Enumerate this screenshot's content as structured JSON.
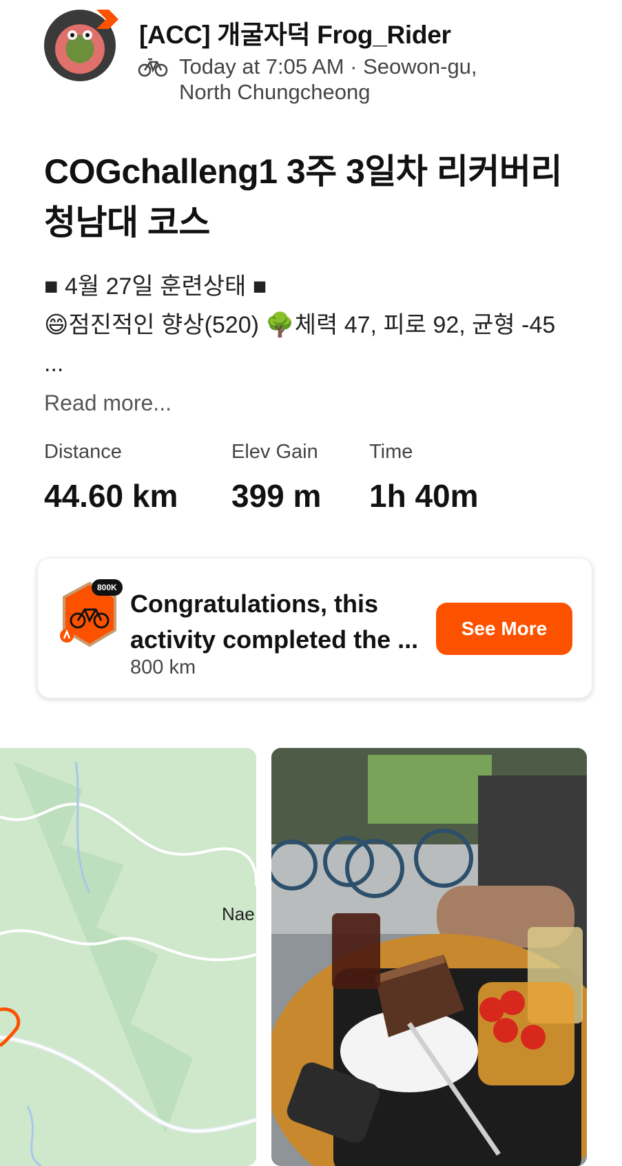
{
  "athlete": {
    "name": "[ACC] 개굴자덕 Frog_Rider",
    "activity_icon": "bike-icon",
    "meta_line1": "Today at 7:05 AM · Seowon-gu,",
    "meta_line2": "North Chungcheong"
  },
  "activity": {
    "title": "COGchalleng1 3주 3일차 리커버리 청남대 코스",
    "description_line1": "■ 4월 27일 훈련상태 ■",
    "description_line2": "😄점진적인 향상(520) 🌳체력 47, 피로 92, 균형 -45",
    "description_ellipsis": "...",
    "read_more": "Read more..."
  },
  "stats": [
    {
      "label": "Distance",
      "value": "44.60 km"
    },
    {
      "label": "Elev Gain",
      "value": "399 m"
    },
    {
      "label": "Time",
      "value": "1h 40m"
    }
  ],
  "achievement": {
    "badge_label": "800K",
    "title": "Congratulations, this activity completed the ...",
    "subtitle": "800 km",
    "button": "See More",
    "accent_color": "#fc5200"
  },
  "media": {
    "map_label": "Nae"
  }
}
